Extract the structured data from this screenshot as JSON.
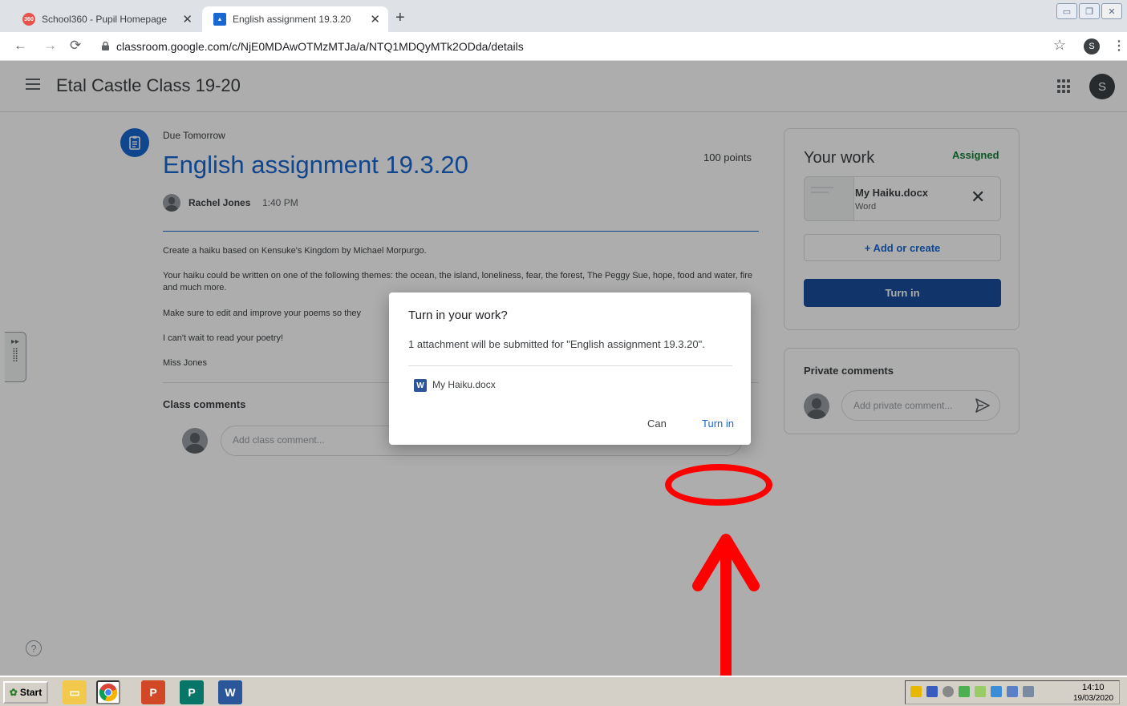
{
  "browser": {
    "tabs": [
      {
        "title": "School360 - Pupil Homepage",
        "active": false
      },
      {
        "title": "English assignment 19.3.20",
        "active": true
      }
    ],
    "url": "classroom.google.com/c/NjE0MDAwOTMzMTJa/a/NTQ1MDQyMTk2ODda/details",
    "profile_initial": "S"
  },
  "app": {
    "class_name": "Etal Castle Class 19-20",
    "avatar_initial": "S"
  },
  "assignment": {
    "due": "Due Tomorrow",
    "title": "English assignment 19.3.20",
    "points": "100 points",
    "teacher": "Rachel Jones",
    "time": "1:40 PM",
    "description": [
      "Create a haiku based on Kensuke's Kingdom by Michael Morpurgo.",
      "Your haiku could be written on one of the following themes: the ocean, the island, loneliness, fear, the forest, The Peggy Sue, hope, food and water, fire and much more.",
      "Make sure to edit and improve your poems so they",
      "I can't wait to read your poetry!",
      "Miss Jones"
    ],
    "class_comments_label": "Class comments",
    "class_comment_placeholder": "Add class comment..."
  },
  "your_work": {
    "title": "Your work",
    "status": "Assigned",
    "attachment": {
      "name": "My Haiku.docx",
      "type": "Word"
    },
    "add_label": "+  Add or create",
    "turn_in_label": "Turn in"
  },
  "private_comments": {
    "title": "Private comments",
    "placeholder": "Add private comment..."
  },
  "dialog": {
    "title": "Turn in your work?",
    "body": "1 attachment will be submitted for \"English assignment 19.3.20\".",
    "file": "My Haiku.docx",
    "file_icon_letter": "W",
    "cancel_label": "Can",
    "turn_in_label": "Turn in"
  },
  "taskbar": {
    "start_label": "Start",
    "time": "14:10",
    "date": "19/03/2020"
  },
  "colors": {
    "accent": "#1967d2",
    "turn_in_button": "#1a4f9c",
    "annotation": "#ff0000",
    "assigned": "#188038"
  }
}
